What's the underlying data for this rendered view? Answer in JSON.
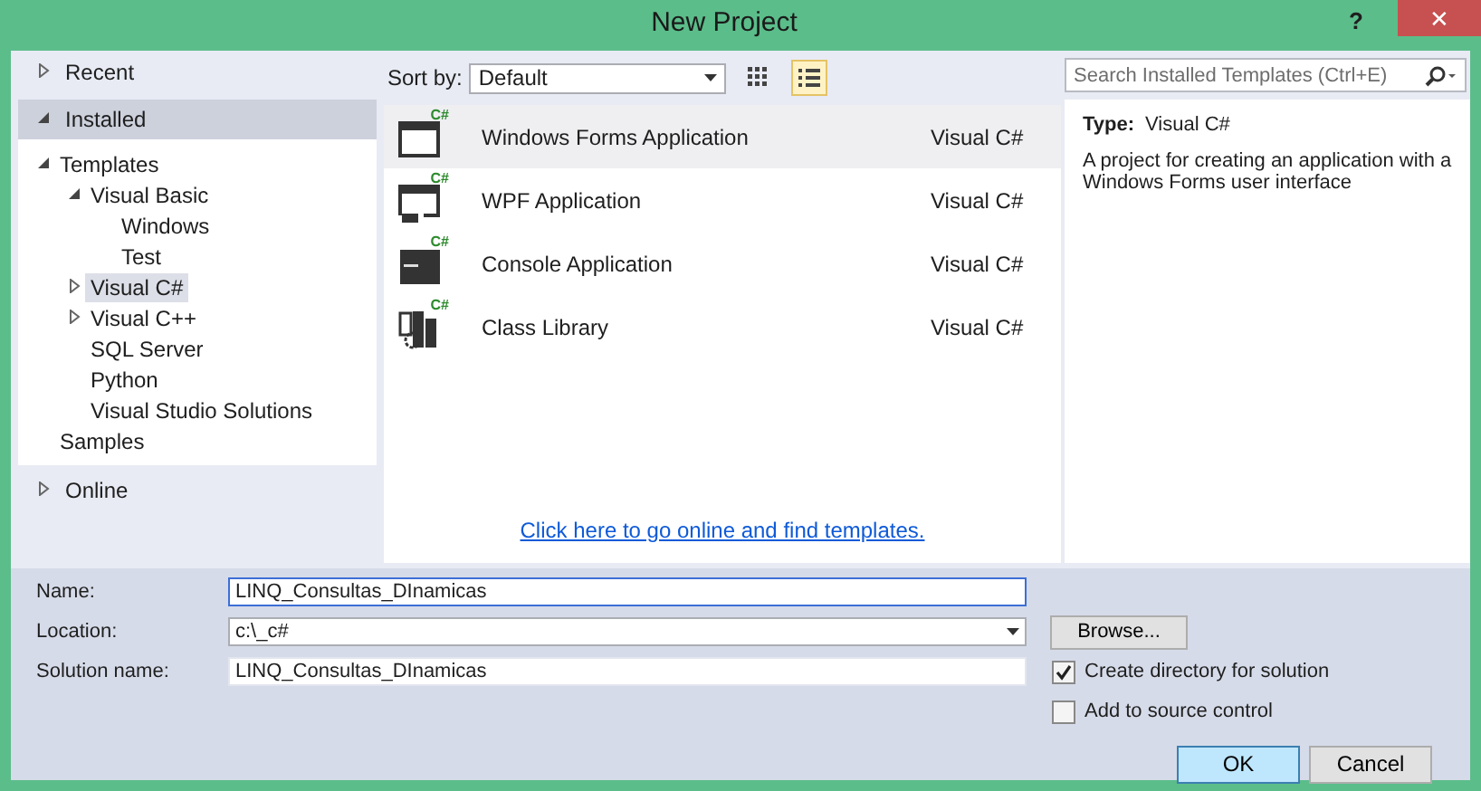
{
  "window": {
    "title": "New Project",
    "help": "?",
    "close": "✕"
  },
  "nav": [
    {
      "label": "Recent",
      "expanded": false,
      "selected": false
    },
    {
      "label": "Installed",
      "expanded": true,
      "selected": true,
      "tree": [
        {
          "label": "Templates",
          "kind": "branch",
          "expanded": true,
          "selected": false,
          "children": [
            {
              "label": "Visual Basic",
              "kind": "branch",
              "expanded": true,
              "selected": false,
              "children": [
                {
                  "label": "Windows",
                  "kind": "leaf",
                  "selected": false
                },
                {
                  "label": "Test",
                  "kind": "leaf",
                  "selected": false
                }
              ]
            },
            {
              "label": "Visual C#",
              "kind": "branch",
              "expanded": false,
              "selected": true
            },
            {
              "label": "Visual C++",
              "kind": "branch",
              "expanded": false,
              "selected": false
            },
            {
              "label": "SQL Server",
              "kind": "leaf",
              "selected": false
            },
            {
              "label": "Python",
              "kind": "leaf",
              "selected": false
            },
            {
              "label": "Visual Studio Solutions",
              "kind": "leaf",
              "selected": false
            }
          ]
        },
        {
          "label": "Samples",
          "kind": "leaf",
          "selected": false
        }
      ]
    },
    {
      "label": "Online",
      "expanded": false,
      "selected": false
    }
  ],
  "toolbar": {
    "sort_label": "Sort by:",
    "sort_value": "Default",
    "views": [
      {
        "kind": "grid",
        "selected": false
      },
      {
        "kind": "list",
        "selected": true
      }
    ]
  },
  "templates": [
    {
      "name": "Windows Forms Application",
      "language": "Visual C#",
      "badge": "C#",
      "kind": "forms",
      "selected": true
    },
    {
      "name": "WPF Application",
      "language": "Visual C#",
      "badge": "C#",
      "kind": "wpf",
      "selected": false
    },
    {
      "name": "Console Application",
      "language": "Visual C#",
      "badge": "C#",
      "kind": "console",
      "selected": false
    },
    {
      "name": "Class Library",
      "language": "Visual C#",
      "badge": "C#",
      "kind": "library",
      "selected": false
    }
  ],
  "online_link": "Click here to go online and find templates.",
  "search": {
    "placeholder": "Search Installed Templates (Ctrl+E)"
  },
  "details": {
    "type_label": "Type:",
    "type_value": "Visual C#",
    "description": "A project for creating an application with a Windows Forms user interface"
  },
  "form": [
    {
      "label": "Name:",
      "value": "LINQ_Consultas_DInamicas",
      "kind": "text",
      "focused": true
    },
    {
      "label": "Location:",
      "value": "c:\\_c#",
      "kind": "combo",
      "focused": false
    },
    {
      "label": "Solution name:",
      "value": "LINQ_Consultas_DInamicas",
      "kind": "text",
      "focused": false
    }
  ],
  "browse": "Browse...",
  "options": [
    {
      "label": "Create directory for solution",
      "checked": true
    },
    {
      "label": "Add to source control",
      "checked": false
    }
  ],
  "buttons": [
    {
      "label": "OK",
      "default": true
    },
    {
      "label": "Cancel",
      "default": false
    }
  ]
}
